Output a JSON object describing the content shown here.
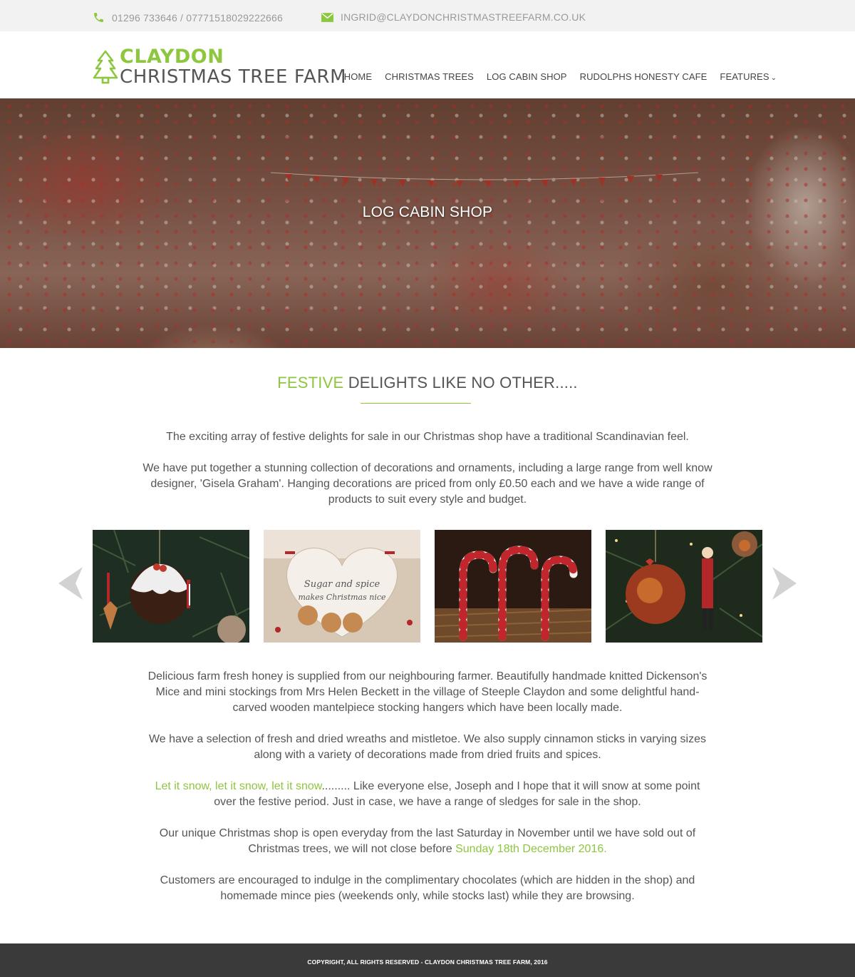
{
  "contact": {
    "phone": "01296 733646 / 07771518029222666",
    "email": "INGRID@CLAYDONCHRISTMASTREEFARM.CO.UK"
  },
  "logo": {
    "line1": "CLAYDON",
    "line2": "CHRISTMAS TREE FARM"
  },
  "nav": {
    "items": [
      {
        "label": "HOME"
      },
      {
        "label": "CHRISTMAS TREES"
      },
      {
        "label": "LOG CABIN SHOP"
      },
      {
        "label": "RUDOLPHS HONESTY CAFE"
      },
      {
        "label": "FEATURES"
      }
    ]
  },
  "hero": {
    "title": "LOG CABIN SHOP"
  },
  "section": {
    "title_accent": "FESTIVE",
    "title_rest": "DELIGHTS LIKE NO OTHER....."
  },
  "intro": {
    "p1": "The exciting array of festive delights for sale in our Christmas shop have a traditional Scandinavian feel.",
    "p2": "We have put together a stunning collection of decorations and ornaments, including a large range from well know designer, 'Gisela Graham'.  Hanging decorations are priced from only £0.50 each and we have a wide range of products to suit every style and budget."
  },
  "gallery": {
    "images": [
      {
        "name": "christmas-pudding-bauble"
      },
      {
        "name": "sugar-and-spice-heart"
      },
      {
        "name": "candy-canes"
      },
      {
        "name": "robin-bauble-and-soldier"
      }
    ],
    "heart_text_1": "Sugar and spice",
    "heart_text_2": "makes Christmas nice"
  },
  "body": {
    "p3": "Delicious farm fresh honey is supplied  from our neighbouring farmer.  Beautifully handmade knitted Dickenson's Mice and mini stockings from Mrs Helen Beckett in the village of Steeple Claydon and some delightful hand-carved wooden mantelpiece stocking hangers which have been locally made.",
    "p4": "We have a selection of fresh and dried wreaths and mistletoe.  We also supply cinnamon sticks in varying sizes along with a variety of decorations made from dried fruits and spices.",
    "p5_highlight": "Let it snow, let it snow, let it snow",
    "p5_rest": "......... Like everyone else, Joseph and I hope that it will snow at some point over the festive period.  Just in case, we have a range of sledges for sale in the shop.",
    "p6_rest": "Our unique Christmas shop is open everyday from the last Saturday in November until we have sold out of Christmas trees, we will not close before ",
    "p6_highlight": "Sunday 18th December 2016.",
    "p7": "Customers are encouraged to indulge in the complimentary chocolates (which are hidden in the shop) and homemade mince pies (weekends only, while stocks last) while they are browsing."
  },
  "footer": {
    "copyright": "COPYRIGHT, ALL RIGHTS RESERVED - CLAYDON CHRISTMAS TREE FARM, 2016"
  },
  "colors": {
    "accent": "#8dc63f",
    "text": "#555555",
    "topbar": "#f2f2f2",
    "footer": "#3a3a3a"
  }
}
